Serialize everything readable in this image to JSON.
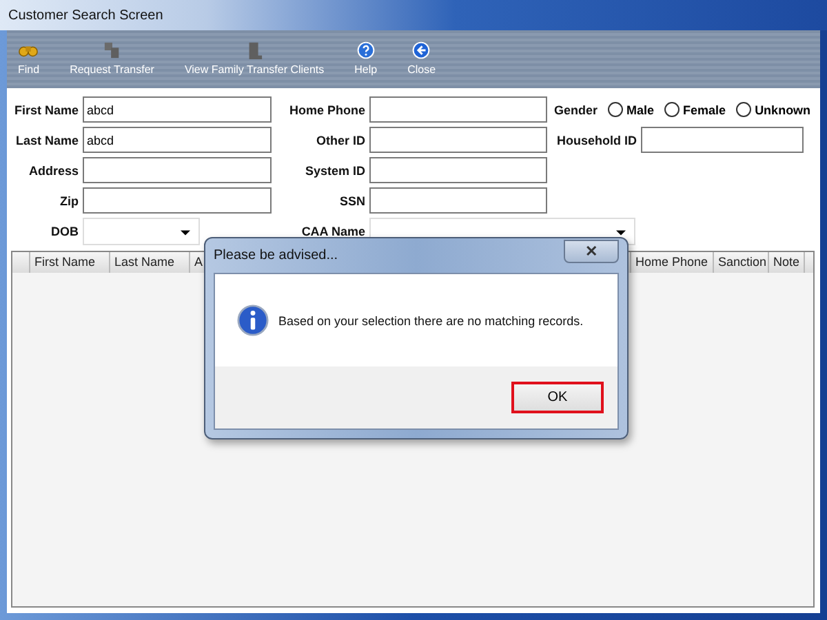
{
  "window": {
    "title": "Customer Search Screen"
  },
  "toolbar": [
    {
      "label": "Find",
      "kind": "find",
      "disabled": false
    },
    {
      "label": "Request Transfer",
      "kind": "transfer",
      "disabled": true
    },
    {
      "label": "View Family Transfer Clients",
      "kind": "family",
      "disabled": true
    },
    {
      "label": "Help",
      "kind": "help",
      "disabled": false
    },
    {
      "label": "Close",
      "kind": "close",
      "disabled": false
    }
  ],
  "form": {
    "first_name": {
      "label": "First Name",
      "value": "abcd"
    },
    "last_name": {
      "label": "Last Name",
      "value": "abcd"
    },
    "address": {
      "label": "Address"
    },
    "zip": {
      "label": "Zip"
    },
    "dob": {
      "label": "DOB"
    },
    "home_phone": {
      "label": "Home Phone"
    },
    "other_id": {
      "label": "Other ID"
    },
    "system_id": {
      "label": "System ID"
    },
    "ssn": {
      "label": "SSN"
    },
    "caa_name": {
      "label": "CAA Name"
    },
    "gender": {
      "label": "Gender",
      "options": [
        {
          "label": "Male",
          "selected": false
        },
        {
          "label": "Female",
          "selected": false
        },
        {
          "label": "Unknown",
          "selected": false
        }
      ]
    },
    "household_id": {
      "label": "Household ID"
    }
  },
  "table": {
    "columns": [
      "First Name",
      "Last Name",
      "A",
      "Home Phone",
      "Sanction",
      "Note"
    ]
  },
  "dialog": {
    "title": "Please be advised...",
    "message": "Based on your selection there are no matching records.",
    "close": "✕",
    "buttons": [
      "OK"
    ]
  }
}
